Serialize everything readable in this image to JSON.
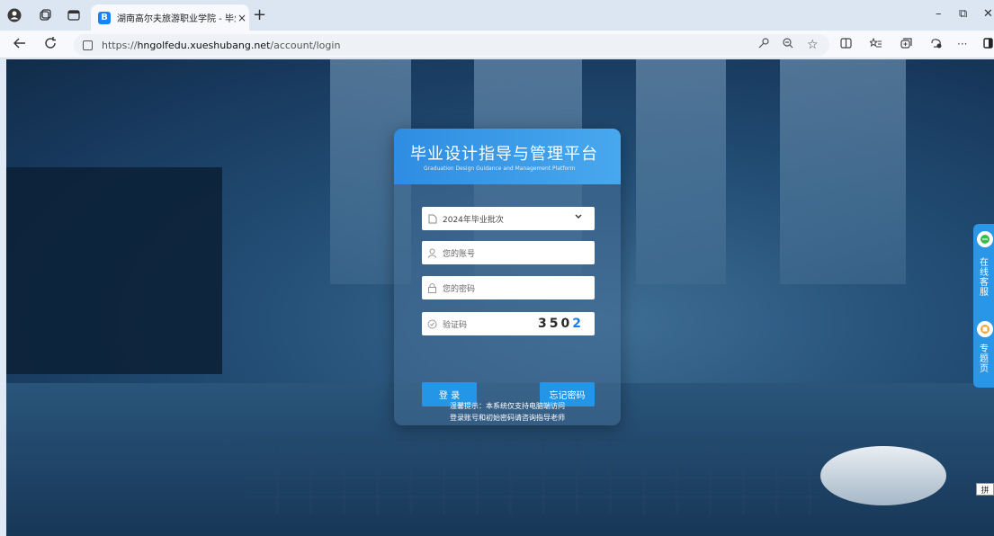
{
  "browser": {
    "tab_title": "湖南高尔夫旅游职业学院 - 毕业设",
    "tab_close": "×",
    "new_tab": "+",
    "url_prefix": "https://",
    "url_host": "hngolfedu.xueshubang.net",
    "url_path": "/account/login",
    "window_controls": {
      "minimize": "–",
      "restore": "⧉",
      "close": "✕"
    },
    "more": "···"
  },
  "login": {
    "title": "毕业设计指导与管理平台",
    "subtitle": "Graduation Design Guidance and Management Platform",
    "batch_value": "2024年毕业批次",
    "account_placeholder": "您的账号",
    "password_placeholder": "您的密码",
    "captcha_placeholder": "验证码",
    "captcha_main": "350",
    "captcha_last": "2",
    "login_button": "登 录",
    "forgot_button": "忘记密码",
    "notice_line1": "温馨提示：本系统仅支持电脑端访问",
    "notice_line2": "登录账号和初始密码请咨询指导老师"
  },
  "sidebar": {
    "service_label": "在线客服",
    "topic_label": "专题页"
  },
  "ime": "拼",
  "colors": {
    "accent": "#2396e8",
    "header": "#2f8de2"
  }
}
